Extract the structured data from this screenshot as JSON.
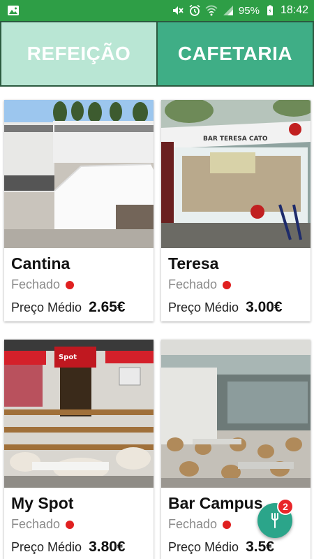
{
  "status_bar": {
    "battery": "95%",
    "time": "18:42",
    "icons": [
      "image-icon",
      "mute-icon",
      "alarm-icon",
      "wifi-icon",
      "signal-icon",
      "battery-icon"
    ]
  },
  "tabs": [
    {
      "label": "REFEIÇÃO",
      "active": false
    },
    {
      "label": "CAFETARIA",
      "active": true
    }
  ],
  "cards": [
    {
      "name": "Cantina",
      "status": "Fechado",
      "price_label": "Preço Médio",
      "price": "2.65€",
      "status_color": "#e02020"
    },
    {
      "name": "Teresa",
      "status": "Fechado",
      "price_label": "Preço Médio",
      "price": "3.00€",
      "status_color": "#e02020"
    },
    {
      "name": "My Spot",
      "status": "Fechado",
      "price_label": "Preço Médio",
      "price": "3.80€",
      "status_color": "#e02020"
    },
    {
      "name": "Bar Campus",
      "status": "Fechado",
      "price_label": "Preço Médio",
      "price": "3.5€",
      "status_color": "#e02020"
    }
  ],
  "fab": {
    "badge": "2",
    "icon": "fork-icon"
  }
}
